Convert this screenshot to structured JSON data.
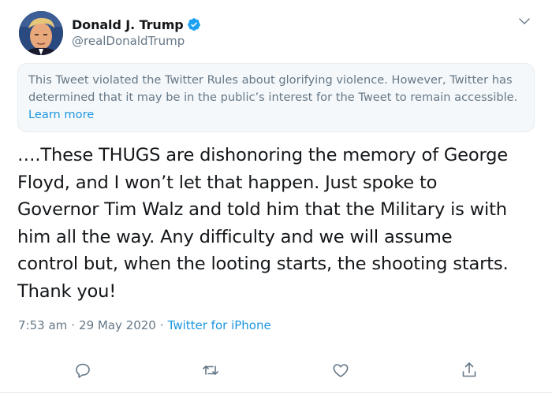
{
  "author": {
    "display_name": "Donald J. Trump",
    "handle": "@realDonaldTrump",
    "verified_icon": "verified-badge-icon",
    "avatar_icon": "profile-photo"
  },
  "notice": {
    "text": "This Tweet violated the Twitter Rules about glorifying violence. However, Twitter has determined that it may be in the public’s interest for the Tweet to remain accessible.",
    "link_label": "Learn more"
  },
  "tweet": {
    "lines": [
      "….These THUGS are dishonoring the memory of George",
      "Floyd, and I won’t let that happen. Just spoke to",
      "Governor Tim Walz and told him that the Military is with",
      "him all the way. Any difficulty and we will assume",
      "control but, when the looting starts, the shooting starts.",
      "Thank you!"
    ]
  },
  "meta": {
    "time": "7:53 am",
    "separator": "·",
    "date": "29 May 2020",
    "source": "Twitter for iPhone"
  },
  "actions": {
    "reply_icon": "reply-icon",
    "retweet_icon": "retweet-icon",
    "like_icon": "heart-icon",
    "share_icon": "share-icon"
  },
  "colors": {
    "accent": "#1b95e0",
    "secondary_text": "#657786",
    "notice_bg": "#f5f8fa",
    "verified": "#1da1f2"
  }
}
